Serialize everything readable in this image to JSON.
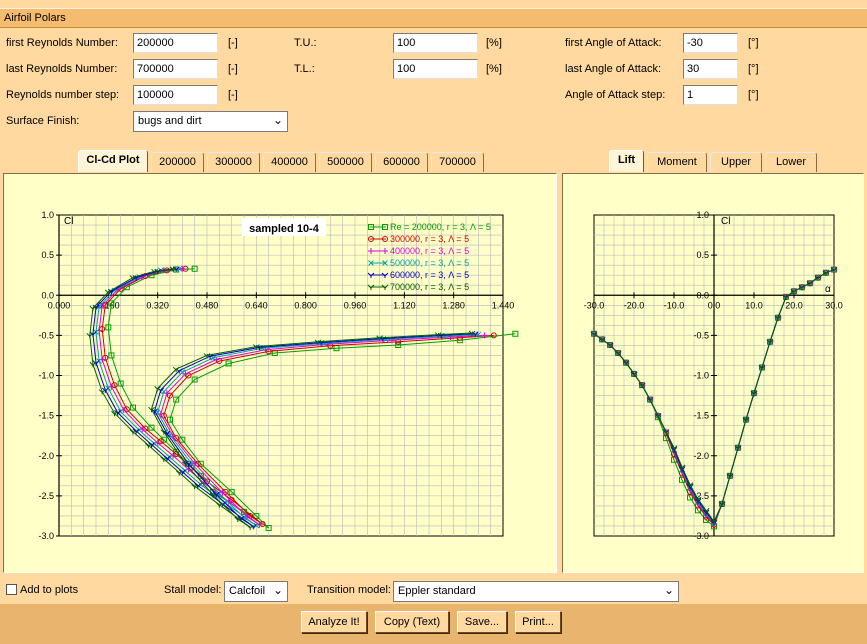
{
  "window": {
    "title": "Airfoil Polars"
  },
  "form": {
    "first_re_label": "first Reynolds Number:",
    "first_re_value": "200000",
    "first_re_unit": "[-]",
    "last_re_label": "last Reynolds Number:",
    "last_re_value": "700000",
    "last_re_unit": "[-]",
    "re_step_label": "Reynolds number step:",
    "re_step_value": "100000",
    "re_step_unit": "[-]",
    "surface_label": "Surface Finish:",
    "surface_value": "bugs and dirt",
    "tu_label": "T.U.:",
    "tu_value": "100",
    "tu_unit": "[%]",
    "tl_label": "T.L.:",
    "tl_value": "100",
    "tl_unit": "[%]",
    "first_aoa_label": "first Angle of Attack:",
    "first_aoa_value": "-30",
    "first_aoa_unit": "[°]",
    "last_aoa_label": "last Angle of Attack:",
    "last_aoa_value": "30",
    "last_aoa_unit": "[°]",
    "aoa_step_label": "Angle of Attack step:",
    "aoa_step_value": "1",
    "aoa_step_unit": "[°]"
  },
  "left_tabs": [
    "Cl-Cd Plot",
    "200000",
    "300000",
    "400000",
    "500000",
    "600000",
    "700000"
  ],
  "right_tabs": [
    "Lift",
    "Moment",
    "Upper",
    "Lower"
  ],
  "bottom": {
    "add_to_plots": "Add to plots",
    "stall_label": "Stall model:",
    "stall_value": "Calcfoil",
    "transition_label": "Transition model:",
    "transition_value": "Eppler standard",
    "analyze": "Analyze It!",
    "copy": "Copy (Text)",
    "save": "Save...",
    "print": "Print..."
  },
  "colors": {
    "grid": "#B8B8B8",
    "s200": "#00A000",
    "s300": "#D00000",
    "s400": "#E000E0",
    "s500": "#00A0A0",
    "s600": "#0000D0",
    "s700": "#006000"
  },
  "chart_data": [
    {
      "type": "line",
      "title": "sampled 10-4",
      "xlabel": "",
      "ylabel": "Cl",
      "xlim": [
        0.0,
        1.44
      ],
      "ylim": [
        -3.0,
        1.0
      ],
      "x_ticks": [
        "0.000",
        "0.160",
        "0.320",
        "0.480",
        "0.640",
        "0.800",
        "0.960",
        "1.120",
        "1.280",
        "1.440"
      ],
      "y_ticks": [
        "1.0",
        "0.5",
        "0.0",
        "-0.5",
        "-1.0",
        "-1.5",
        "-2.0",
        "-2.5",
        "-3.0"
      ],
      "legend": [
        "Re = 200000, r = 3, Λ = 5",
        "300000, r = 3, Λ = 5",
        "400000, r = 3, Λ = 5",
        "500000, r = 3, Λ = 5",
        "600000, r = 3, Λ = 5",
        "700000, r = 3, Λ = 5"
      ],
      "legend_position": "top-right",
      "series": [
        {
          "name": "Re = 200000, r = 3, Λ = 5",
          "x": [
            0.44,
            0.38,
            0.3,
            0.22,
            0.17,
            0.16,
            0.17,
            0.2,
            0.24,
            0.3,
            0.34,
            0.38,
            0.42,
            0.46,
            0.5,
            0.6,
            0.68,
            0.64,
            0.56,
            0.46,
            0.4,
            0.36,
            0.38,
            0.44,
            0.55,
            0.7,
            0.9,
            1.1,
            1.3,
            1.48
          ],
          "y": [
            0.33,
            0.32,
            0.25,
            0.1,
            -0.1,
            -0.4,
            -0.75,
            -1.1,
            -1.4,
            -1.65,
            -1.8,
            -1.95,
            -2.1,
            -2.25,
            -2.45,
            -2.7,
            -2.9,
            -2.75,
            -2.45,
            -2.1,
            -1.8,
            -1.55,
            -1.3,
            -1.05,
            -0.85,
            -0.72,
            -0.66,
            -0.62,
            -0.56,
            -0.48
          ]
        },
        {
          "name": "300000, r = 3, Λ = 5",
          "x": [
            0.41,
            0.35,
            0.28,
            0.2,
            0.15,
            0.14,
            0.15,
            0.18,
            0.22,
            0.28,
            0.33,
            0.38,
            0.43,
            0.48,
            0.56,
            0.66,
            0.62,
            0.54,
            0.45,
            0.38,
            0.34,
            0.36,
            0.42,
            0.52,
            0.68,
            0.88,
            1.1,
            1.3,
            1.41
          ],
          "y": [
            0.33,
            0.31,
            0.24,
            0.08,
            -0.12,
            -0.42,
            -0.78,
            -1.12,
            -1.42,
            -1.66,
            -1.82,
            -1.98,
            -2.15,
            -2.32,
            -2.55,
            -2.85,
            -2.75,
            -2.45,
            -2.1,
            -1.78,
            -1.5,
            -1.25,
            -1.0,
            -0.82,
            -0.7,
            -0.63,
            -0.58,
            -0.53,
            -0.5
          ]
        },
        {
          "name": "400000, r = 3, Λ = 5",
          "x": [
            0.4,
            0.34,
            0.27,
            0.19,
            0.14,
            0.13,
            0.14,
            0.17,
            0.21,
            0.27,
            0.32,
            0.37,
            0.42,
            0.47,
            0.55,
            0.65,
            0.61,
            0.53,
            0.44,
            0.37,
            0.33,
            0.35,
            0.41,
            0.51,
            0.67,
            0.87,
            1.08,
            1.27,
            1.38
          ],
          "y": [
            0.33,
            0.31,
            0.23,
            0.07,
            -0.13,
            -0.44,
            -0.8,
            -1.14,
            -1.43,
            -1.67,
            -1.84,
            -2.0,
            -2.17,
            -2.34,
            -2.57,
            -2.86,
            -2.76,
            -2.46,
            -2.1,
            -1.76,
            -1.48,
            -1.22,
            -0.98,
            -0.8,
            -0.68,
            -0.61,
            -0.56,
            -0.52,
            -0.5
          ]
        },
        {
          "name": "500000, r = 3, Λ = 5",
          "x": [
            0.39,
            0.33,
            0.26,
            0.18,
            0.13,
            0.12,
            0.13,
            0.16,
            0.2,
            0.26,
            0.31,
            0.36,
            0.41,
            0.46,
            0.54,
            0.64,
            0.6,
            0.52,
            0.43,
            0.36,
            0.32,
            0.34,
            0.4,
            0.5,
            0.66,
            0.86,
            1.06,
            1.25,
            1.36
          ],
          "y": [
            0.33,
            0.31,
            0.23,
            0.06,
            -0.14,
            -0.46,
            -0.82,
            -1.16,
            -1.45,
            -1.68,
            -1.85,
            -2.02,
            -2.19,
            -2.36,
            -2.59,
            -2.87,
            -2.77,
            -2.47,
            -2.1,
            -1.74,
            -1.46,
            -1.2,
            -0.96,
            -0.78,
            -0.66,
            -0.6,
            -0.55,
            -0.51,
            -0.49
          ]
        },
        {
          "name": "600000, r = 3, Λ = 5",
          "x": [
            0.38,
            0.32,
            0.25,
            0.17,
            0.12,
            0.11,
            0.12,
            0.15,
            0.19,
            0.25,
            0.3,
            0.35,
            0.4,
            0.45,
            0.53,
            0.63,
            0.59,
            0.51,
            0.42,
            0.35,
            0.31,
            0.33,
            0.39,
            0.49,
            0.65,
            0.85,
            1.05,
            1.24,
            1.35
          ],
          "y": [
            0.33,
            0.3,
            0.22,
            0.05,
            -0.15,
            -0.48,
            -0.84,
            -1.18,
            -1.46,
            -1.69,
            -1.86,
            -2.03,
            -2.2,
            -2.37,
            -2.6,
            -2.88,
            -2.78,
            -2.48,
            -2.1,
            -1.72,
            -1.44,
            -1.18,
            -0.94,
            -0.76,
            -0.65,
            -0.59,
            -0.54,
            -0.5,
            -0.48
          ]
        },
        {
          "name": "700000, r = 3, Λ = 5",
          "x": [
            0.37,
            0.31,
            0.24,
            0.16,
            0.11,
            0.1,
            0.11,
            0.14,
            0.18,
            0.24,
            0.29,
            0.34,
            0.39,
            0.44,
            0.52,
            0.62,
            0.58,
            0.5,
            0.41,
            0.34,
            0.3,
            0.32,
            0.38,
            0.48,
            0.64,
            0.84,
            1.04,
            1.23,
            1.34
          ],
          "y": [
            0.33,
            0.3,
            0.22,
            0.04,
            -0.16,
            -0.5,
            -0.86,
            -1.2,
            -1.47,
            -1.7,
            -1.87,
            -2.04,
            -2.21,
            -2.38,
            -2.61,
            -2.89,
            -2.79,
            -2.49,
            -2.1,
            -1.7,
            -1.42,
            -1.16,
            -0.92,
            -0.75,
            -0.64,
            -0.58,
            -0.53,
            -0.49,
            -0.47
          ]
        }
      ]
    },
    {
      "type": "line",
      "title": "",
      "xlabel": "α",
      "ylabel": "Cl",
      "xlim": [
        -30,
        30
      ],
      "ylim": [
        -3.0,
        1.0
      ],
      "x_ticks": [
        "-30.0",
        "-20.0",
        "-10.0",
        "0.0",
        "10.0",
        "20.0",
        "30.0"
      ],
      "y_ticks": [
        "1.0",
        "0.5",
        "0.0",
        "-0.5",
        "-1.0",
        "-1.5",
        "-2.0",
        "-2.5",
        "-3.0"
      ],
      "series": [
        {
          "name": "200000",
          "x": [
            -30,
            -28,
            -26,
            -24,
            -22,
            -20,
            -18,
            -16,
            -14,
            -12,
            -10,
            -8,
            -6,
            -4,
            -2,
            0,
            2,
            4,
            6,
            8,
            10,
            12,
            14,
            16,
            18,
            20,
            22,
            24,
            26,
            28,
            30
          ],
          "y": [
            -0.48,
            -0.55,
            -0.62,
            -0.72,
            -0.84,
            -0.98,
            -1.12,
            -1.3,
            -1.52,
            -1.78,
            -2.05,
            -2.3,
            -2.52,
            -2.68,
            -2.8,
            -2.88,
            -2.6,
            -2.25,
            -1.9,
            -1.55,
            -1.22,
            -0.9,
            -0.58,
            -0.28,
            -0.02,
            0.05,
            0.1,
            0.15,
            0.22,
            0.28,
            0.32
          ]
        },
        {
          "name": "300000",
          "x": [
            -30,
            -28,
            -26,
            -24,
            -22,
            -20,
            -18,
            -16,
            -14,
            -12,
            -10,
            -8,
            -6,
            -4,
            -2,
            0,
            2,
            4,
            6,
            8,
            10,
            12,
            14,
            16,
            18,
            20,
            22,
            24,
            26,
            28,
            30
          ],
          "y": [
            -0.48,
            -0.55,
            -0.62,
            -0.72,
            -0.84,
            -0.98,
            -1.12,
            -1.3,
            -1.5,
            -1.72,
            -1.98,
            -2.22,
            -2.45,
            -2.62,
            -2.76,
            -2.86,
            -2.6,
            -2.25,
            -1.9,
            -1.55,
            -1.22,
            -0.9,
            -0.58,
            -0.28,
            -0.02,
            0.05,
            0.1,
            0.15,
            0.22,
            0.28,
            0.32
          ]
        },
        {
          "name": "400000",
          "x": [
            -30,
            -28,
            -26,
            -24,
            -22,
            -20,
            -18,
            -16,
            -14,
            -12,
            -10,
            -8,
            -6,
            -4,
            -2,
            0,
            2,
            4,
            6,
            8,
            10,
            12,
            14,
            16,
            18,
            20,
            22,
            24,
            26,
            28,
            30
          ],
          "y": [
            -0.48,
            -0.55,
            -0.62,
            -0.72,
            -0.84,
            -0.98,
            -1.12,
            -1.3,
            -1.5,
            -1.7,
            -1.95,
            -2.2,
            -2.42,
            -2.6,
            -2.74,
            -2.85,
            -2.6,
            -2.25,
            -1.9,
            -1.55,
            -1.22,
            -0.9,
            -0.58,
            -0.28,
            -0.02,
            0.05,
            0.1,
            0.15,
            0.22,
            0.28,
            0.32
          ]
        },
        {
          "name": "500000",
          "x": [
            -30,
            -28,
            -26,
            -24,
            -22,
            -20,
            -18,
            -16,
            -14,
            -12,
            -10,
            -8,
            -6,
            -4,
            -2,
            0,
            2,
            4,
            6,
            8,
            10,
            12,
            14,
            16,
            18,
            20,
            22,
            24,
            26,
            28,
            30
          ],
          "y": [
            -0.48,
            -0.55,
            -0.62,
            -0.72,
            -0.84,
            -0.98,
            -1.12,
            -1.3,
            -1.5,
            -1.7,
            -1.93,
            -2.18,
            -2.4,
            -2.58,
            -2.72,
            -2.84,
            -2.6,
            -2.25,
            -1.9,
            -1.55,
            -1.22,
            -0.9,
            -0.58,
            -0.28,
            -0.02,
            0.05,
            0.1,
            0.15,
            0.22,
            0.28,
            0.32
          ]
        },
        {
          "name": "600000",
          "x": [
            -30,
            -28,
            -26,
            -24,
            -22,
            -20,
            -18,
            -16,
            -14,
            -12,
            -10,
            -8,
            -6,
            -4,
            -2,
            0,
            2,
            4,
            6,
            8,
            10,
            12,
            14,
            16,
            18,
            20,
            22,
            24,
            26,
            28,
            30
          ],
          "y": [
            -0.48,
            -0.55,
            -0.62,
            -0.72,
            -0.84,
            -0.98,
            -1.12,
            -1.3,
            -1.5,
            -1.7,
            -1.92,
            -2.16,
            -2.38,
            -2.56,
            -2.7,
            -2.83,
            -2.6,
            -2.25,
            -1.9,
            -1.55,
            -1.22,
            -0.9,
            -0.58,
            -0.28,
            -0.02,
            0.05,
            0.1,
            0.15,
            0.22,
            0.28,
            0.32
          ]
        },
        {
          "name": "700000",
          "x": [
            -30,
            -28,
            -26,
            -24,
            -22,
            -20,
            -18,
            -16,
            -14,
            -12,
            -10,
            -8,
            -6,
            -4,
            -2,
            0,
            2,
            4,
            6,
            8,
            10,
            12,
            14,
            16,
            18,
            20,
            22,
            24,
            26,
            28,
            30
          ],
          "y": [
            -0.48,
            -0.55,
            -0.62,
            -0.72,
            -0.84,
            -0.98,
            -1.12,
            -1.3,
            -1.5,
            -1.7,
            -1.9,
            -2.14,
            -2.36,
            -2.54,
            -2.68,
            -2.82,
            -2.6,
            -2.25,
            -1.9,
            -1.55,
            -1.22,
            -0.9,
            -0.58,
            -0.28,
            -0.02,
            0.05,
            0.1,
            0.15,
            0.22,
            0.28,
            0.32
          ]
        }
      ]
    }
  ]
}
